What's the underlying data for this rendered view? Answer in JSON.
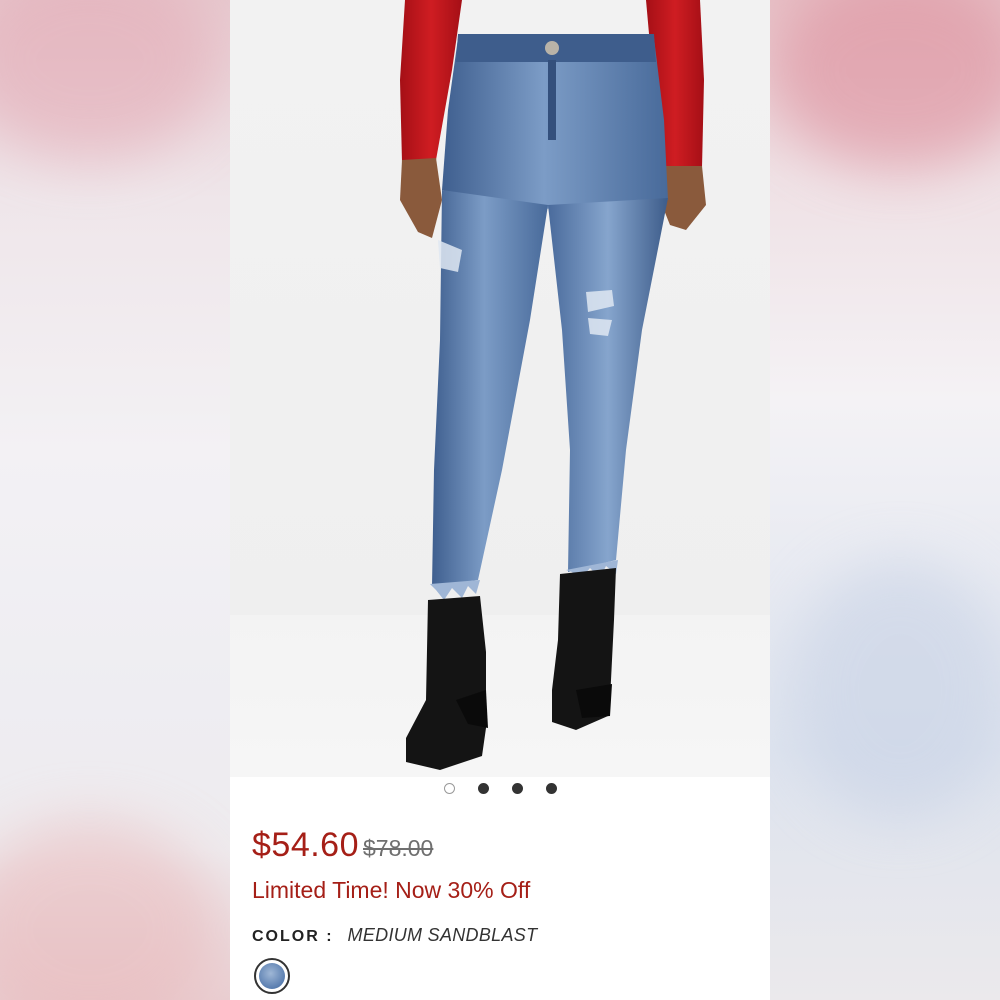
{
  "carousel": {
    "image_alt": "Model wearing distressed skinny ankle jeans with red top and black ankle boots",
    "slide_count": 4,
    "active_index": 0
  },
  "product": {
    "sale_price": "$54.60",
    "original_price": "$78.00",
    "promo": "Limited Time! Now 30% Off",
    "color_label": "COLOR :",
    "color_value": "MEDIUM SANDBLAST",
    "swatches": [
      "medium-sandblast"
    ]
  },
  "colors": {
    "sale": "#a51f17",
    "strikethrough": "#6f6f6f",
    "denim": "#5a7eb0",
    "top": "#c0141a"
  }
}
